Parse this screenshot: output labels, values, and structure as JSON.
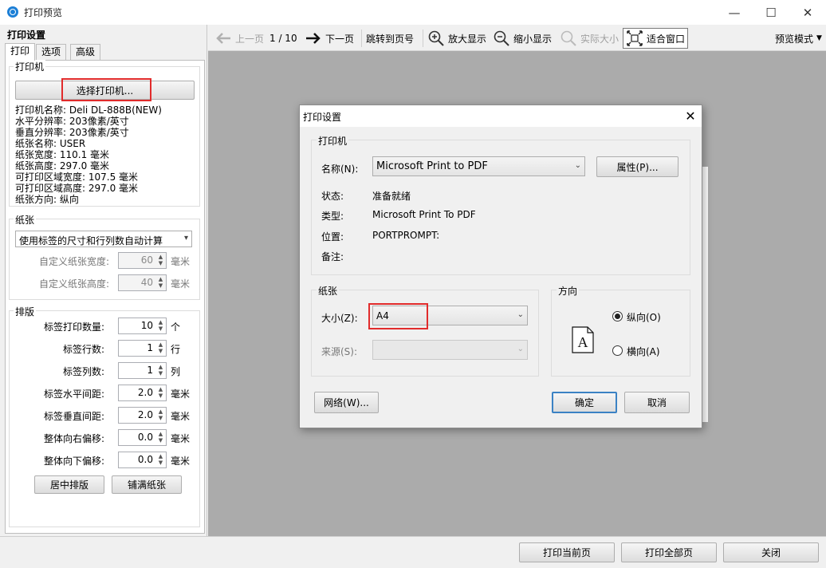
{
  "window": {
    "title": "打印预览",
    "minimize_icon": "—",
    "maximize_icon": "☐",
    "close_icon": "✕"
  },
  "left_panel": {
    "title": "打印设置",
    "tabs": [
      "打印",
      "选项",
      "高级"
    ],
    "printer": {
      "group_label": "打印机",
      "select_button": "选择打印机...",
      "info": [
        "打印机名称: Deli DL-888B(NEW)",
        "水平分辨率: 203像素/英寸",
        "垂直分辨率: 203像素/英寸",
        "纸张名称: USER",
        "纸张宽度: 110.1 毫米",
        "纸张高度: 297.0 毫米",
        "可打印区域宽度: 107.5 毫米",
        "可打印区域高度: 297.0 毫米",
        "纸张方向: 纵向"
      ]
    },
    "paper": {
      "group_label": "纸张",
      "mode": "使用标签的尺寸和行列数自动计算",
      "custom_width_label": "自定义纸张宽度:",
      "custom_width": "60",
      "custom_height_label": "自定义纸张高度:",
      "custom_height": "40",
      "unit": "毫米"
    },
    "layout": {
      "group_label": "排版",
      "rows": [
        {
          "label": "标签打印数量:",
          "value": "10",
          "unit": "个"
        },
        {
          "label": "标签行数:",
          "value": "1",
          "unit": "行"
        },
        {
          "label": "标签列数:",
          "value": "1",
          "unit": "列"
        },
        {
          "label": "标签水平间距:",
          "value": "2.0",
          "unit": "毫米"
        },
        {
          "label": "标签垂直间距:",
          "value": "2.0",
          "unit": "毫米"
        },
        {
          "label": "整体向右偏移:",
          "value": "0.0",
          "unit": "毫米"
        },
        {
          "label": "整体向下偏移:",
          "value": "0.0",
          "unit": "毫米"
        }
      ],
      "center_button": "居中排版",
      "fill_button": "铺满纸张"
    }
  },
  "toolbar": {
    "prev": "上一页",
    "page_indicator": "1 / 10",
    "next": "下一页",
    "jump": "跳转到页号",
    "zoom_in": "放大显示",
    "zoom_out": "缩小显示",
    "actual_size": "实际大小",
    "fit_window": "适合窗口",
    "preview_mode": "预览模式"
  },
  "bottom": {
    "print_current": "打印当前页",
    "print_all": "打印全部页",
    "close": "关闭"
  },
  "dialog": {
    "title": "打印设置",
    "printer_group": "打印机",
    "name_label": "名称(N):",
    "name_value": "Microsoft Print to PDF",
    "properties_button": "属性(P)...",
    "status_label": "状态:",
    "status_value": "准备就绪",
    "type_label": "类型:",
    "type_value": "Microsoft Print To PDF",
    "where_label": "位置:",
    "where_value": "PORTPROMPT:",
    "comment_label": "备注:",
    "comment_value": "",
    "paper_group": "纸张",
    "size_label": "大小(Z):",
    "size_value": "A4",
    "source_label": "来源(S):",
    "source_value": "",
    "orientation_group": "方向",
    "portrait_label": "纵向(O)",
    "landscape_label": "横向(A)",
    "orientation_selected": "portrait",
    "orientation_glyph": "A",
    "network_button": "网络(W)...",
    "ok_button": "确定",
    "cancel_button": "取消"
  },
  "colors": {
    "highlight_red": "#e12b2b",
    "app_icon_blue": "#1c7fd6",
    "preview_background": "#ababab"
  }
}
